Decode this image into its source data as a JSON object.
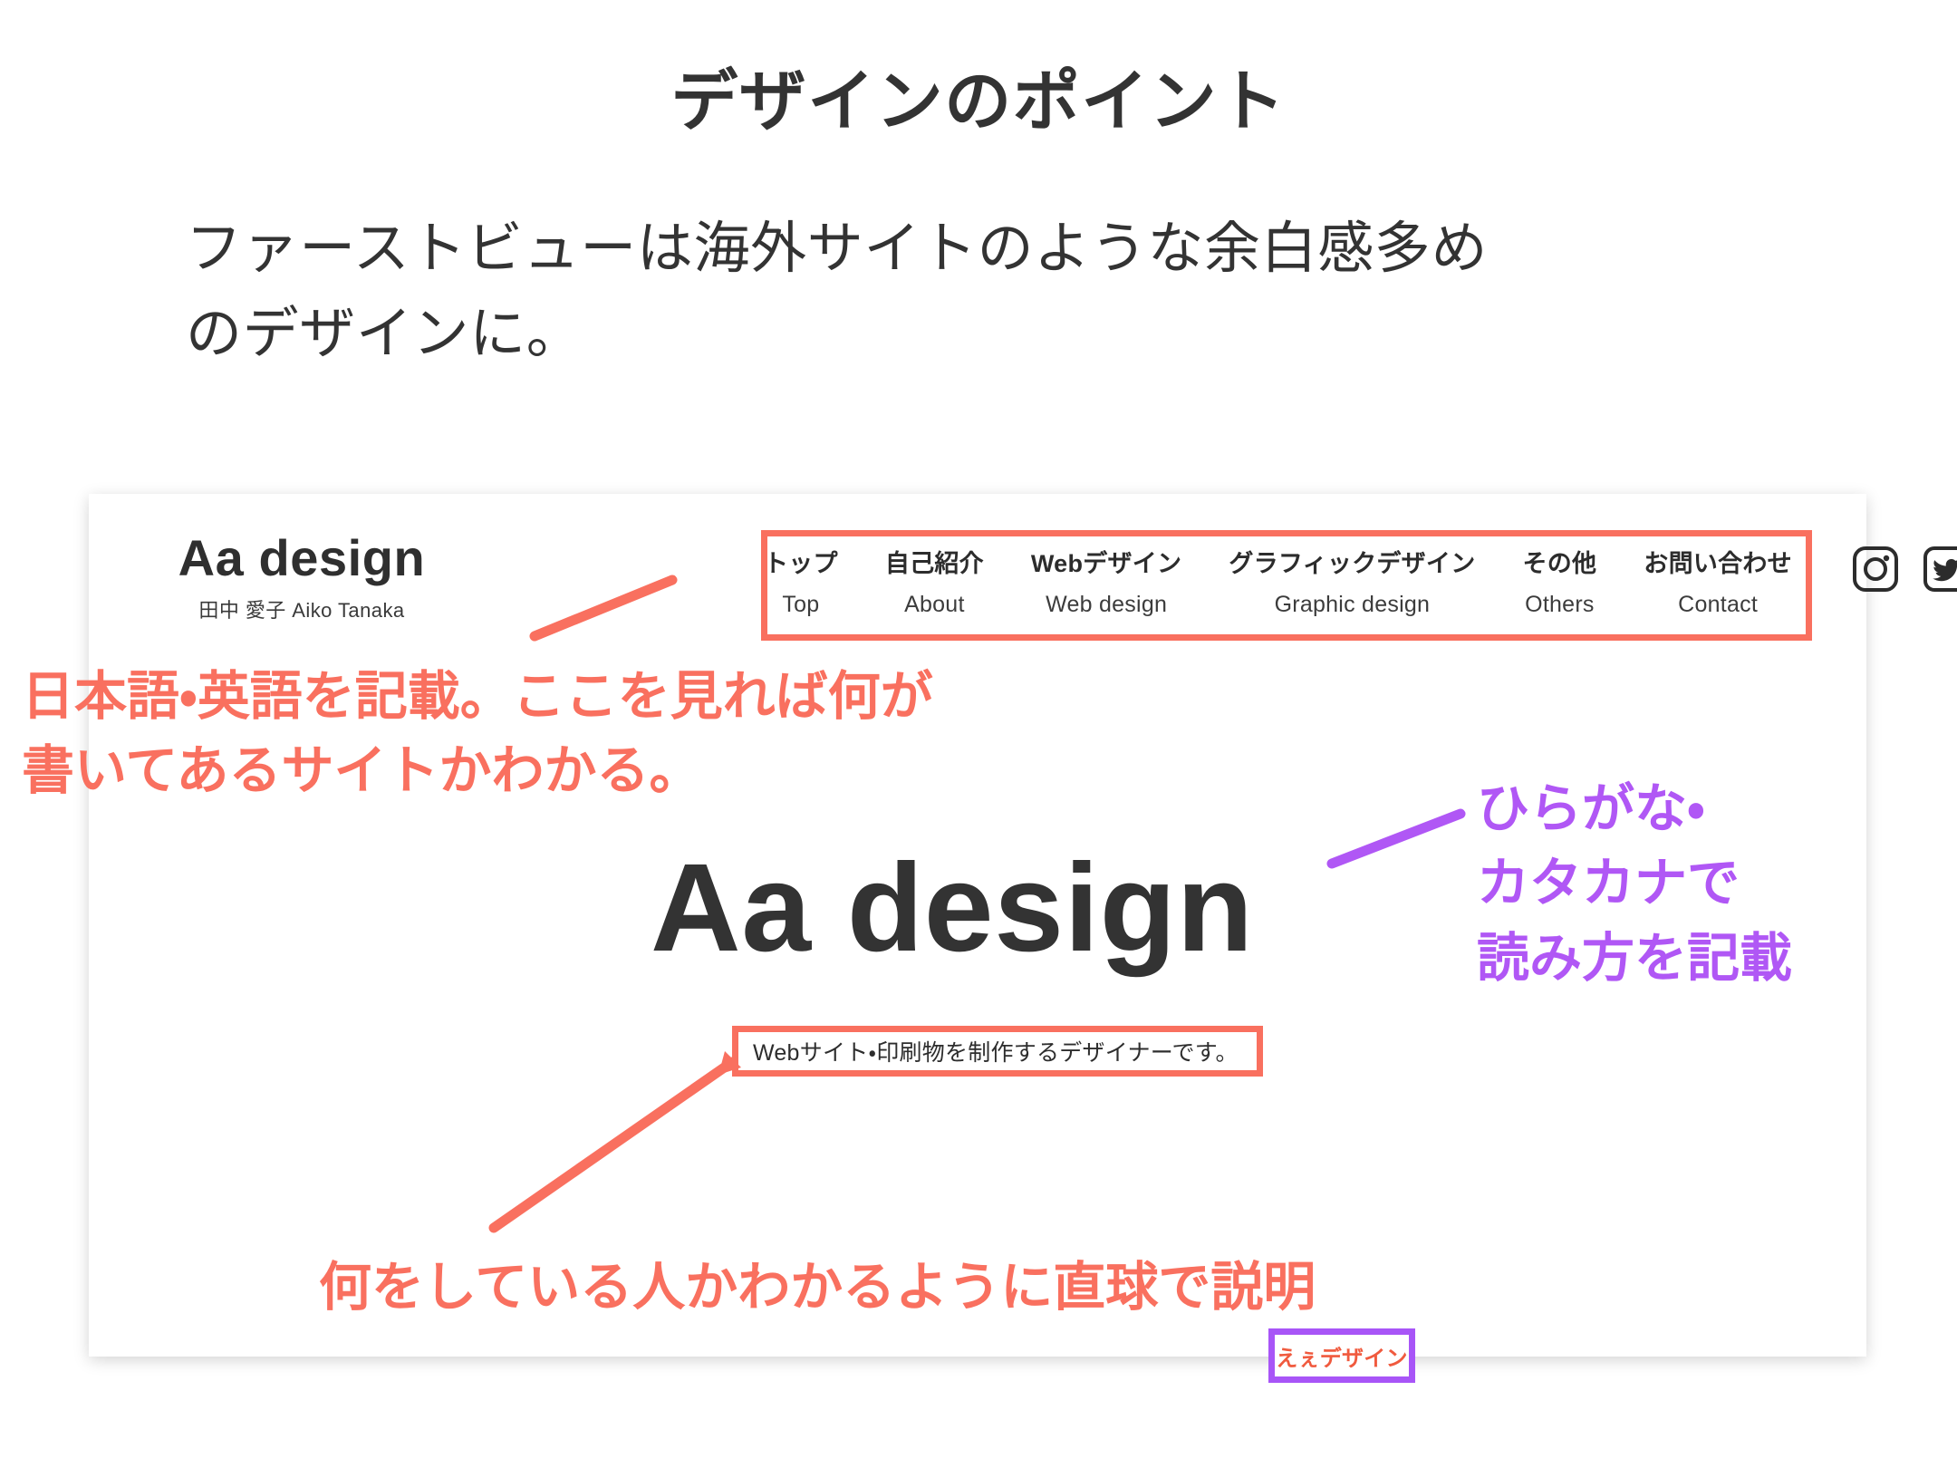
{
  "slide": {
    "title": "デザインのポイント",
    "lead_lines": [
      "ファーストビューは海外サイトのような余白感多め",
      "のデザインに。"
    ]
  },
  "colors": {
    "accent_orange": "#f9705f",
    "accent_purple": "#b057f5",
    "reading_text": "#f05a3e",
    "text_dark": "#333333"
  },
  "mock_site": {
    "brand": {
      "name": "Aa design",
      "subtitle": "田中 愛子  Aiko Tanaka"
    },
    "nav": [
      {
        "ja": "トップ",
        "en": "Top"
      },
      {
        "ja": "自己紹介",
        "en": "About"
      },
      {
        "ja": "Webデザイン",
        "en": "Web design"
      },
      {
        "ja": "グラフィックデザイン",
        "en": "Graphic design"
      },
      {
        "ja": "その他",
        "en": "Others"
      },
      {
        "ja": "お問い合わせ",
        "en": "Contact"
      }
    ],
    "social": [
      {
        "icon": "instagram-icon",
        "label": "Instagram"
      },
      {
        "icon": "twitter-icon",
        "label": "Twitter"
      }
    ],
    "hero": {
      "title": "Aa design",
      "tagline": "Webサイト・印刷物を制作するデザイナーです。",
      "reading": "えぇデザイン"
    }
  },
  "annotations": {
    "nav": {
      "color": "#f9705f",
      "lines": [
        "日本語・英語を記載。ここを見れば何が",
        "書いてあるサイトかわかる。"
      ]
    },
    "reading": {
      "color": "#b057f5",
      "lines": [
        "ひらがな・",
        "カタカナで",
        "読み方を記載"
      ]
    },
    "tagline": {
      "color": "#f9705f",
      "text": "何をしている人かわかるように直球で説明"
    }
  }
}
